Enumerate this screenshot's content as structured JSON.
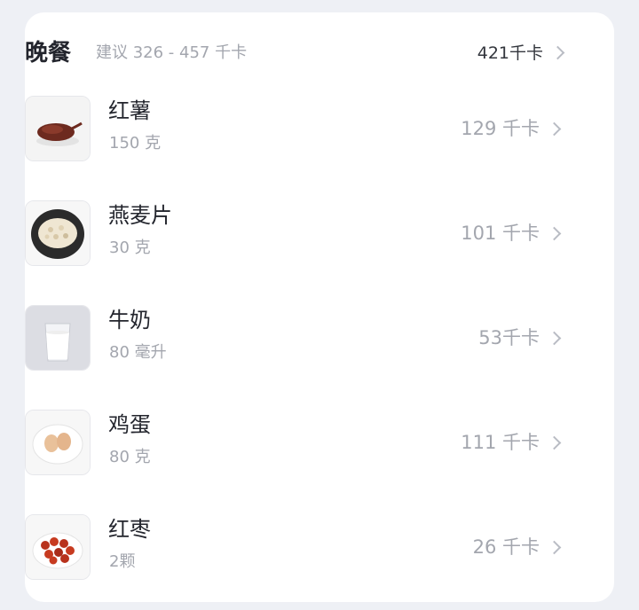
{
  "meal": {
    "title": "晚餐",
    "suggestion": "建议 326 - 457 千卡",
    "total": "421千卡"
  },
  "items": [
    {
      "name": "红薯",
      "amount": "150 克",
      "kcal": "129 千卡",
      "icon": "sweet-potato"
    },
    {
      "name": "燕麦片",
      "amount": "30 克",
      "kcal": "101 千卡",
      "icon": "oatmeal"
    },
    {
      "name": "牛奶",
      "amount": "80 毫升",
      "kcal": "53千卡",
      "icon": "milk"
    },
    {
      "name": "鸡蛋",
      "amount": "80 克",
      "kcal": "111 千卡",
      "icon": "eggs"
    },
    {
      "name": "红枣",
      "amount": "2颗",
      "kcal": "26 千卡",
      "icon": "red-dates"
    }
  ]
}
